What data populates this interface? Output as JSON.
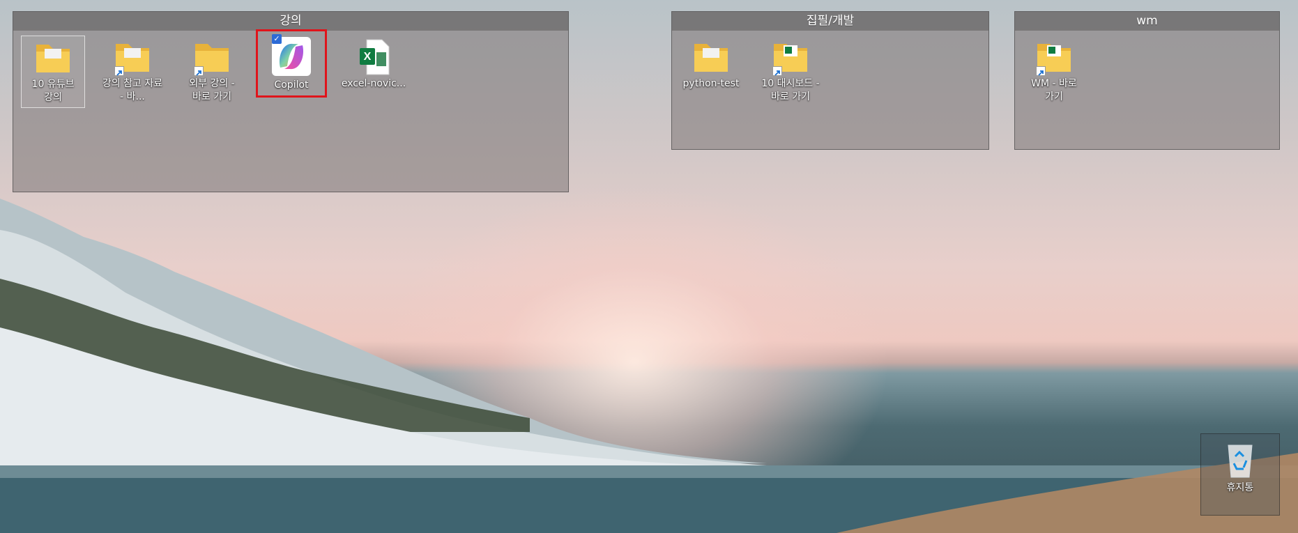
{
  "desktop": {
    "fences": [
      {
        "title": "강의",
        "items": [
          {
            "label": "10 유튜브 강의",
            "icon": "folder-icon",
            "shortcut": false
          },
          {
            "label": "강의 참고 자료 - 바...",
            "icon": "folder-shortcut-icon",
            "shortcut": true
          },
          {
            "label": "외부 강의 - 바로 가기",
            "icon": "folder-shortcut-icon",
            "shortcut": true
          },
          {
            "label": "Copilot",
            "icon": "copilot-icon",
            "shortcut": false
          },
          {
            "label": "excel-novic...",
            "icon": "excel-file-icon",
            "shortcut": false
          }
        ]
      },
      {
        "title": "집필/개발",
        "items": [
          {
            "label": "python-test",
            "icon": "folder-icon",
            "shortcut": false
          },
          {
            "label": "10 대시보드 - 바로 가기",
            "icon": "excel-folder-shortcut-icon",
            "shortcut": true
          }
        ]
      },
      {
        "title": "wm",
        "items": [
          {
            "label": "WM - 바로 가기",
            "icon": "excel-folder-shortcut-icon",
            "shortcut": true
          }
        ]
      }
    ],
    "recycle_bin": {
      "label": "휴지통",
      "icon": "recycle-bin-icon"
    },
    "highlight_color": "#e0141b"
  }
}
